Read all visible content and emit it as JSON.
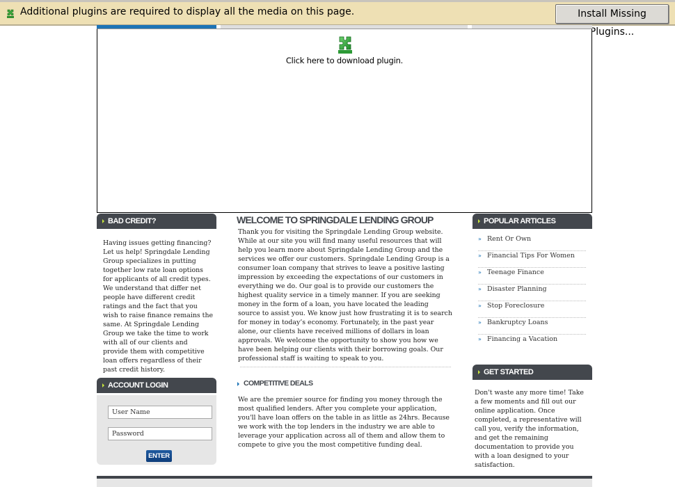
{
  "plugin_bar": {
    "message": "Additional plugins are required to display all the media on this page.",
    "install_button": "Install Missing Plugins...",
    "icon": "puzzle-piece-icon"
  },
  "plugin_area": {
    "download_text": "Click here to download plugin.",
    "icon": "puzzle-piece-icon"
  },
  "colors": {
    "accent_blue": "#1d74b6",
    "header_dark": "#43474d",
    "arrow_green": "#c8e63c",
    "notification_bg": "#eee0b4"
  },
  "left": {
    "bad_credit": {
      "title": "Bad Credit?",
      "text": "Having issues getting financing? Let us help! Springdale Lending Group specializes in putting together low rate loan options for applicants of all credit types. We understand that differ net people have different credit ratings and the fact that you wish to raise finance remains the same. At Springdale Lending Group we take the time to work with all of our clients and provide them with competitive loan offers regardless of their past credit history."
    },
    "login": {
      "title": "Account Login",
      "username_value": "User Name",
      "password_value": "Password",
      "enter_label": "ENTER"
    }
  },
  "center": {
    "welcome_title": "Welcome to Springdale Lending Group",
    "welcome_text": "Thank you for visiting the Springdale Lending Group website. While at our site you will find many useful resources that will help you learn more about Springdale Lending Group and the services we offer our customers. Springdale Lending Group is a consumer loan company that strives to leave a positive lasting impression by exceeding the expectations of our customers in everything we do. Our goal is to provide our customers the highest quality service in a timely manner. If you are seeking money in the form of a loan, you have located the leading source to assist you. We know just how frustrating it is to search for money in today’s economy. Fortunately, in the past year alone, our clients have received millions of dollars in loan approvals. We welcome the opportunity to show you how we have been helping our clients with their borrowing goals. Our professional staff is waiting to speak to you.",
    "competitive_title": "Competitive Deals",
    "competitive_text": "We are the premier source for finding you money through the most qualified lenders. After you complete your application, you'll have loan offers on the table in as little as 24hrs. Because we work with the top lenders in the industry we are able to leverage your application across all of them and allow them to compete to give you the most competitive funding deal."
  },
  "right": {
    "popular_title": "Popular Articles",
    "articles": [
      {
        "label": "Rent Or Own"
      },
      {
        "label": "Financial Tips For Women"
      },
      {
        "label": "Teenage Finance"
      },
      {
        "label": "Disaster Planning"
      },
      {
        "label": "Stop Foreclosure"
      },
      {
        "label": "Bankruptcy Loans"
      },
      {
        "label": "Financing a Vacation"
      }
    ],
    "bullet": "»",
    "get_started_title": "Get Started",
    "get_started_text": "Don't waste any more time! Take a few moments and fill out our online application. Once completed, a representative will call you, verify the information, and get the remaining documentation to provide you with a loan designed to your satisfaction."
  }
}
